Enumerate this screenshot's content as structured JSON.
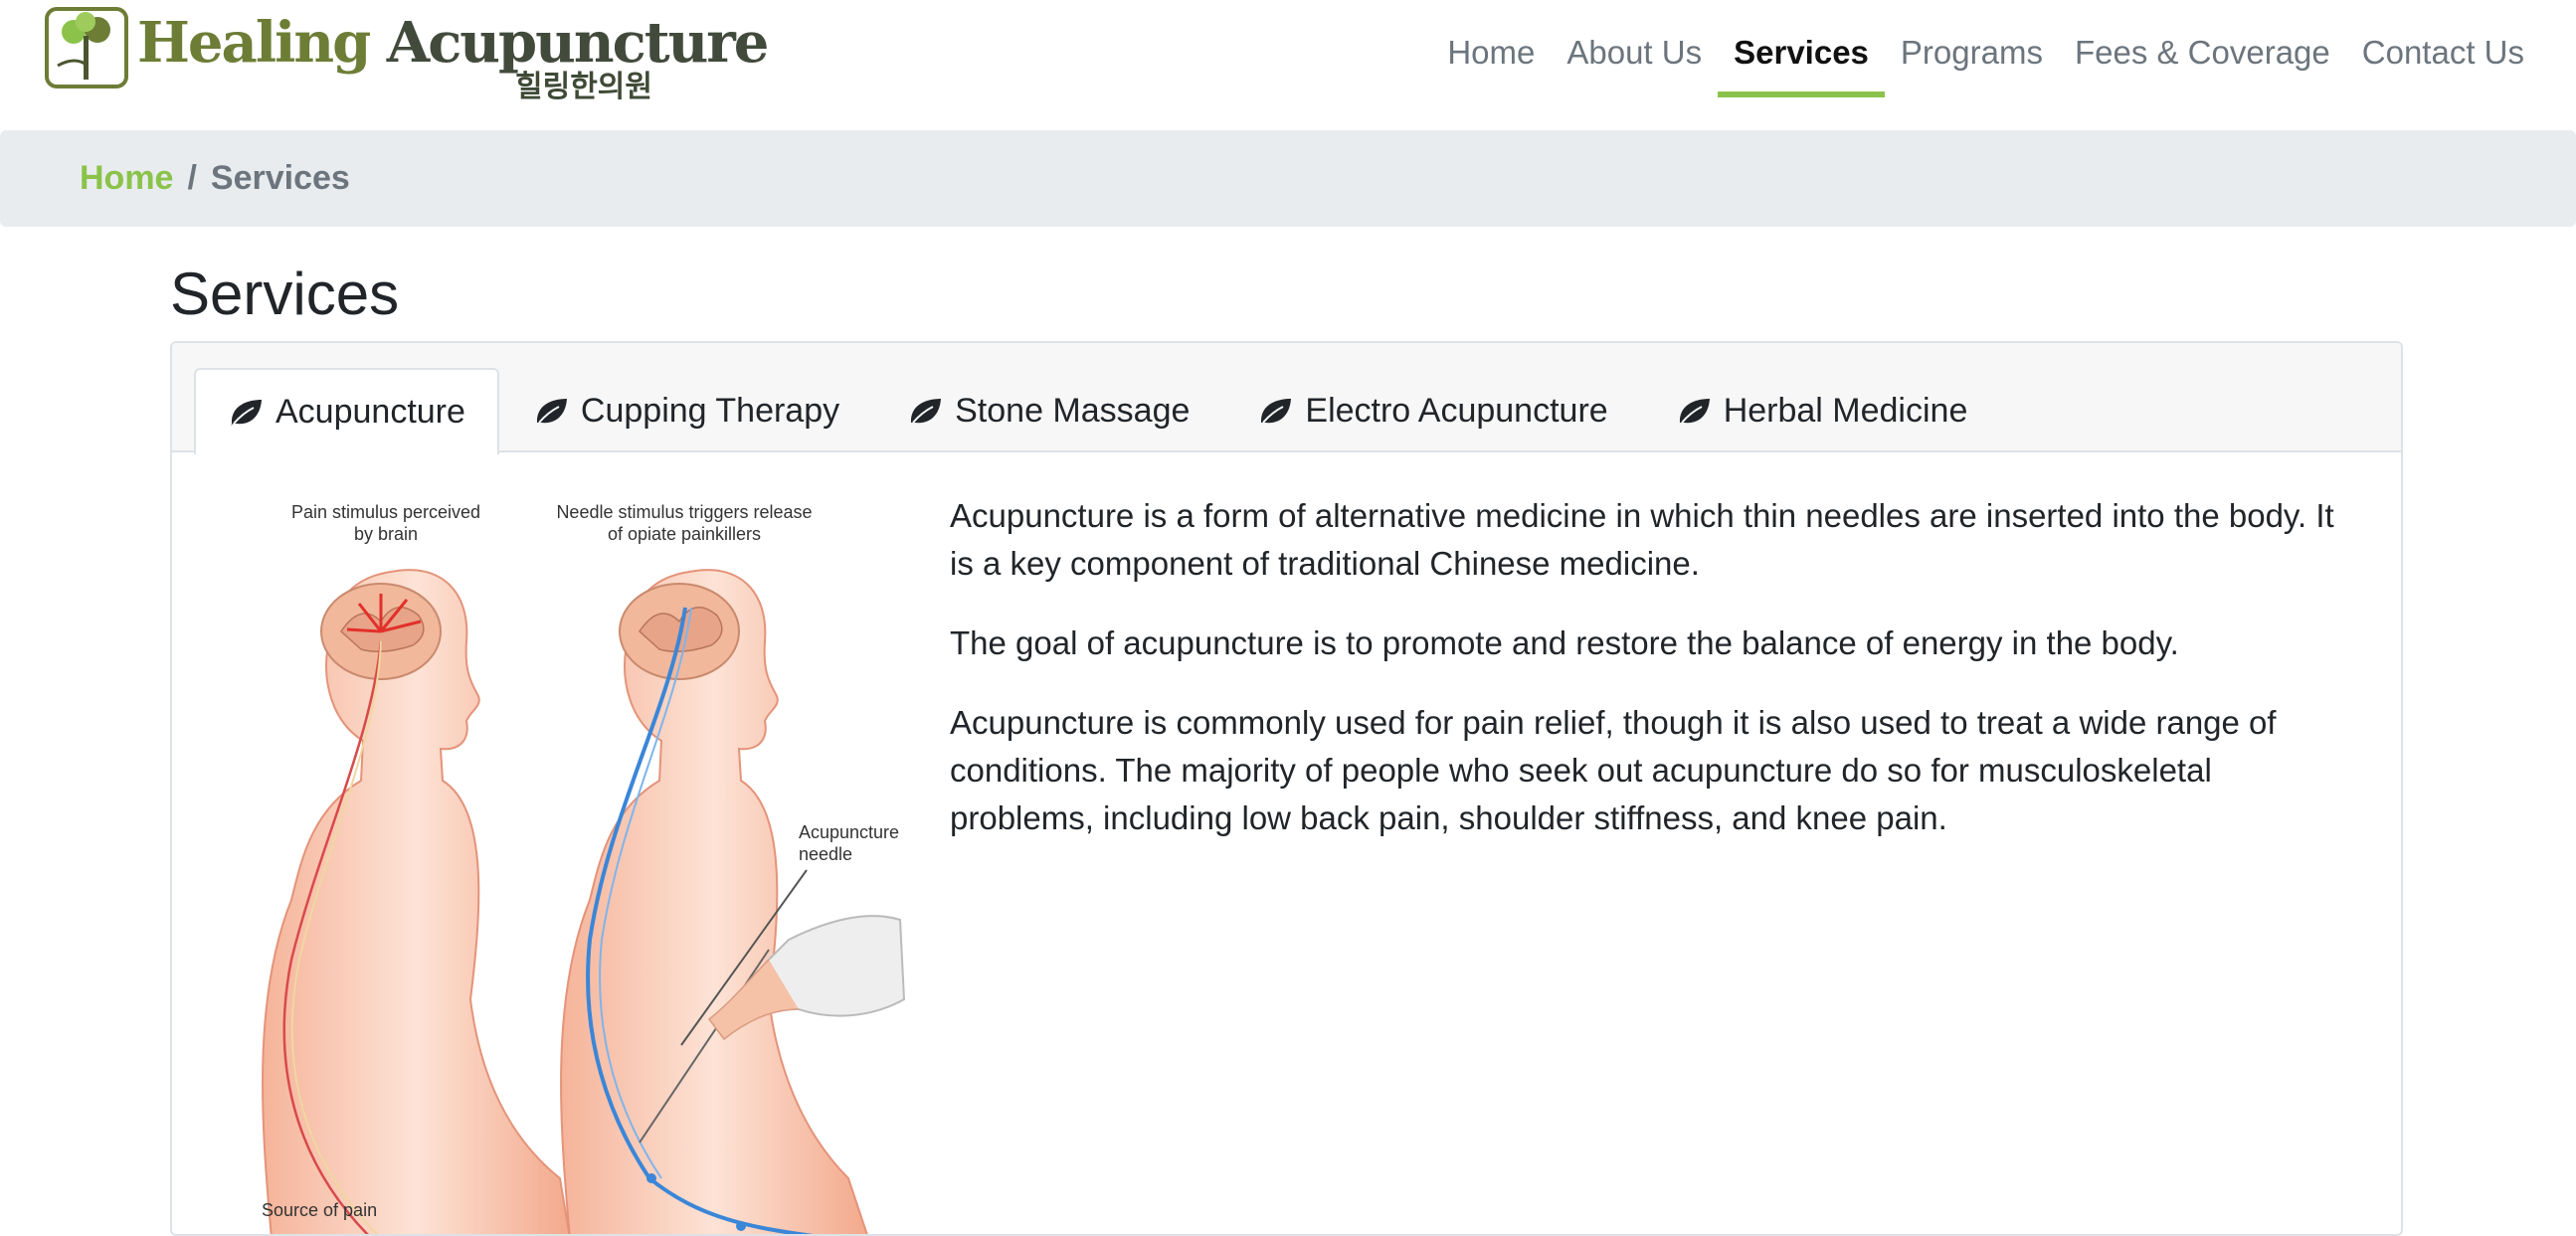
{
  "brand": {
    "name_word1": "Healing",
    "name_word2": "Acupuncture",
    "korean_name": "힐링한의원",
    "accent_color": "#8bc34a",
    "logo_green": "#6d7d36"
  },
  "nav": {
    "items": [
      {
        "label": "Home"
      },
      {
        "label": "About Us"
      },
      {
        "label": "Services",
        "active": true
      },
      {
        "label": "Programs"
      },
      {
        "label": "Fees & Coverage"
      },
      {
        "label": "Contact Us"
      }
    ]
  },
  "breadcrumb": {
    "home": "Home",
    "separator": "/",
    "current": "Services"
  },
  "page": {
    "title": "Services"
  },
  "tabs": [
    {
      "label": "Acupuncture",
      "icon": "leaf-icon",
      "active": true
    },
    {
      "label": "Cupping Therapy",
      "icon": "leaf-icon"
    },
    {
      "label": "Stone Massage",
      "icon": "leaf-icon"
    },
    {
      "label": "Electro Acupuncture",
      "icon": "leaf-icon"
    },
    {
      "label": "Herbal Medicine",
      "icon": "leaf-icon"
    }
  ],
  "content": {
    "paragraphs": [
      "Acupuncture is a form of alternative medicine in which thin needles are inserted into the body. It is a key component of traditional Chinese medicine.",
      "The goal of acupuncture is to promote and restore the balance of energy in the body.",
      "Acupuncture is commonly used for pain relief, though it is also used to treat a wide range of conditions. The majority of people who seek out acupuncture do so for musculoskeletal problems, including low back pain, shoulder stiffness, and knee pain."
    ]
  },
  "illustration": {
    "label_pain_line1": "Pain stimulus perceived",
    "label_pain_line2": "by brain",
    "label_needle_line1": "Needle stimulus triggers release",
    "label_needle_line2": "of opiate painkillers",
    "label_acu_line1": "Acupuncture",
    "label_acu_line2": "needle",
    "label_source": "Source of pain"
  }
}
